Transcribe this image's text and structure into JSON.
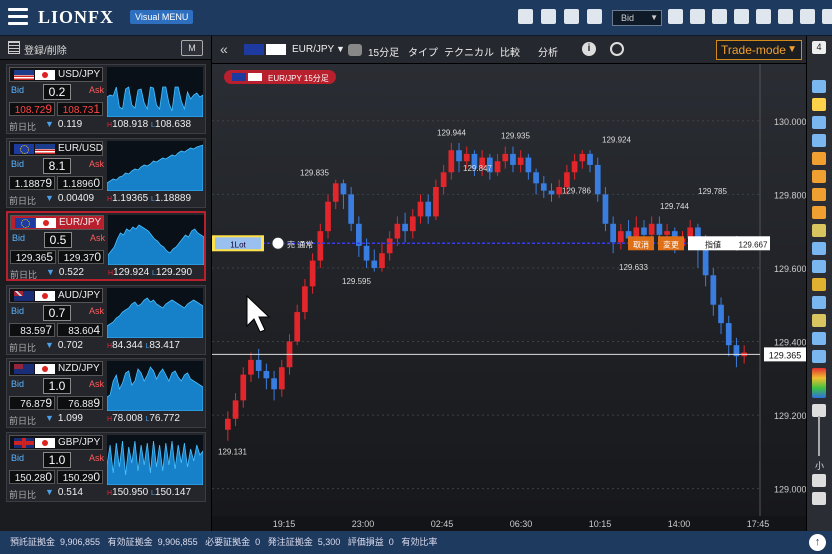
{
  "app": {
    "logo": "LIONFX",
    "logo_badge": "Visual MENU",
    "bid_select": "Bid"
  },
  "sidebar": {
    "title": "登録/削除",
    "m_button": "M",
    "cards": [
      {
        "pair": "USD/JPY",
        "flags": [
          "fl-us",
          "fl-jp"
        ],
        "spread": "0.2",
        "bid_main": "108.72",
        "bid_sub": "9",
        "ask_main": "108.73",
        "ask_sub": "1",
        "red": true,
        "change_label": "前日比",
        "change": "0.119",
        "high": "108.918",
        "low": "108.638",
        "spark": [
          20,
          22,
          21,
          30,
          10,
          8,
          28,
          30,
          12,
          9,
          27,
          28,
          14,
          8,
          30,
          29,
          12,
          8,
          30,
          30,
          14,
          6,
          30,
          30,
          16,
          8,
          25,
          18,
          22,
          24,
          20,
          22
        ]
      },
      {
        "pair": "EUR/USD",
        "flags": [
          "fl-eu",
          "fl-us"
        ],
        "spread": "8.1",
        "bid_main": "1.1887",
        "bid_sub": "9",
        "ask_main": "1.1896",
        "ask_sub": "0",
        "red": false,
        "change_label": "前日比",
        "change": "0.00409",
        "high": "1.19365",
        "low": "1.18889",
        "spark": [
          8,
          10,
          12,
          11,
          14,
          15,
          18,
          17,
          20,
          22,
          21,
          24,
          26,
          25,
          27,
          30,
          29,
          31,
          33,
          32,
          34,
          36,
          35,
          38,
          40,
          39,
          41,
          43,
          42,
          44,
          45,
          46
        ]
      },
      {
        "pair": "EUR/JPY",
        "flags": [
          "fl-eu",
          "fl-jp"
        ],
        "spread": "0.5",
        "bid_main": "129.36",
        "bid_sub": "5",
        "ask_main": "129.37",
        "ask_sub": "0",
        "red": false,
        "selected": true,
        "change_label": "前日比",
        "change": "0.522",
        "high": "129.924",
        "low": "129.290",
        "spark": [
          10,
          14,
          18,
          26,
          32,
          30,
          36,
          34,
          38,
          36,
          40,
          38,
          36,
          34,
          30,
          26,
          24,
          20,
          18,
          14,
          12,
          16,
          18,
          22,
          26,
          30,
          28,
          34,
          36,
          32,
          30,
          28
        ]
      },
      {
        "pair": "AUD/JPY",
        "flags": [
          "fl-au",
          "fl-jp"
        ],
        "spread": "0.7",
        "bid_main": "83.59",
        "bid_sub": "7",
        "ask_main": "83.60",
        "ask_sub": "4",
        "red": false,
        "change_label": "前日比",
        "change": "0.702",
        "high": "84.344",
        "low": "83.417",
        "spark": [
          12,
          14,
          16,
          20,
          22,
          26,
          28,
          30,
          34,
          36,
          32,
          34,
          38,
          40,
          36,
          38,
          34,
          32,
          30,
          34,
          36,
          38,
          36,
          34,
          32,
          30,
          34,
          36,
          38,
          36,
          34,
          32
        ]
      },
      {
        "pair": "NZD/JPY",
        "flags": [
          "fl-nz",
          "fl-jp"
        ],
        "spread": "1.0",
        "bid_main": "76.87",
        "bid_sub": "9",
        "ask_main": "76.88",
        "ask_sub": "9",
        "red": false,
        "change_label": "前日比",
        "change": "1.099",
        "high": "78.008",
        "low": "76.772",
        "spark": [
          14,
          16,
          30,
          36,
          22,
          28,
          38,
          40,
          26,
          30,
          42,
          38,
          30,
          36,
          44,
          40,
          32,
          38,
          42,
          36,
          30,
          38,
          40,
          34,
          30,
          36,
          38,
          32,
          30,
          28,
          26,
          24
        ]
      },
      {
        "pair": "GBP/JPY",
        "flags": [
          "fl-gb",
          "fl-jp"
        ],
        "spread": "1.0",
        "bid_main": "150.28",
        "bid_sub": "0",
        "ask_main": "150.29",
        "ask_sub": "0",
        "red": false,
        "change_label": "前日比",
        "change": "0.514",
        "high": "150.950",
        "low": "150.147",
        "spark": [
          20,
          40,
          12,
          42,
          18,
          44,
          10,
          38,
          22,
          44,
          14,
          40,
          20,
          42,
          12,
          44,
          18,
          40,
          14,
          42,
          20,
          44,
          16,
          40,
          22,
          42,
          18,
          36,
          24,
          40,
          30,
          34
        ]
      }
    ]
  },
  "chart_toolbar": {
    "pair": "EUR/JPY",
    "timeframe": "15分足",
    "type": "タイプ",
    "technical": "テクニカル",
    "compare": "比較",
    "analysis": "分析",
    "trade_mode": "Trade-mode"
  },
  "chart_data": {
    "type": "candlestick",
    "title": "EUR/JPY 15分足",
    "ylim": [
      128.98,
      130.1
    ],
    "y_ticks": [
      "130.000",
      "129.800",
      "129.600",
      "129.400",
      "129.200",
      "129.000"
    ],
    "x_ticks": [
      "19:15",
      "23:00",
      "02:45",
      "06:30",
      "10:15",
      "14:00",
      "17:45"
    ],
    "annotations": [
      "129.944",
      "129.935",
      "129.924",
      "129.835",
      "129.847",
      "129.786",
      "129.744",
      "129.785",
      "129.633",
      "129.595",
      "129.131"
    ],
    "current_price": "129.365",
    "order_line": {
      "price": "129.667",
      "lot": "1Lot",
      "type": "売 通常",
      "cancel": "取消",
      "change": "変更",
      "limit": "指値"
    },
    "candles": [
      [
        129.16,
        129.19,
        129.13,
        129.21
      ],
      [
        129.19,
        129.24,
        129.17,
        129.26
      ],
      [
        129.24,
        129.31,
        129.22,
        129.33
      ],
      [
        129.31,
        129.35,
        129.29,
        129.37
      ],
      [
        129.35,
        129.32,
        129.3,
        129.38
      ],
      [
        129.32,
        129.3,
        129.27,
        129.34
      ],
      [
        129.3,
        129.27,
        129.24,
        129.32
      ],
      [
        129.27,
        129.33,
        129.25,
        129.35
      ],
      [
        129.33,
        129.4,
        129.31,
        129.42
      ],
      [
        129.4,
        129.48,
        129.39,
        129.5
      ],
      [
        129.48,
        129.55,
        129.46,
        129.57
      ],
      [
        129.55,
        129.62,
        129.53,
        129.64
      ],
      [
        129.62,
        129.7,
        129.6,
        129.72
      ],
      [
        129.7,
        129.78,
        129.68,
        129.8
      ],
      [
        129.78,
        129.83,
        129.76,
        129.84
      ],
      [
        129.83,
        129.8,
        129.76,
        129.84
      ],
      [
        129.8,
        129.72,
        129.7,
        129.82
      ],
      [
        129.72,
        129.66,
        129.63,
        129.74
      ],
      [
        129.66,
        129.62,
        129.6,
        129.68
      ],
      [
        129.62,
        129.6,
        129.59,
        129.65
      ],
      [
        129.6,
        129.64,
        129.59,
        129.67
      ],
      [
        129.64,
        129.68,
        129.62,
        129.7
      ],
      [
        129.68,
        129.72,
        129.66,
        129.74
      ],
      [
        129.72,
        129.7,
        129.67,
        129.75
      ],
      [
        129.7,
        129.74,
        129.68,
        129.76
      ],
      [
        129.74,
        129.78,
        129.72,
        129.8
      ],
      [
        129.78,
        129.74,
        129.72,
        129.8
      ],
      [
        129.74,
        129.82,
        129.73,
        129.84
      ],
      [
        129.82,
        129.86,
        129.8,
        129.88
      ],
      [
        129.86,
        129.92,
        129.84,
        129.94
      ],
      [
        129.92,
        129.89,
        129.86,
        129.94
      ],
      [
        129.89,
        129.91,
        129.87,
        129.93
      ],
      [
        129.91,
        129.87,
        129.85,
        129.92
      ],
      [
        129.87,
        129.9,
        129.85,
        129.92
      ],
      [
        129.9,
        129.86,
        129.84,
        129.91
      ],
      [
        129.86,
        129.89,
        129.85,
        129.91
      ],
      [
        129.89,
        129.91,
        129.87,
        129.93
      ],
      [
        129.91,
        129.88,
        129.86,
        129.93
      ],
      [
        129.88,
        129.9,
        129.86,
        129.92
      ],
      [
        129.9,
        129.86,
        129.84,
        129.91
      ],
      [
        129.86,
        129.83,
        129.8,
        129.87
      ],
      [
        129.83,
        129.81,
        129.79,
        129.85
      ],
      [
        129.81,
        129.8,
        129.78,
        129.83
      ],
      [
        129.8,
        129.82,
        129.79,
        129.84
      ],
      [
        129.82,
        129.86,
        129.8,
        129.88
      ],
      [
        129.86,
        129.89,
        129.84,
        129.91
      ],
      [
        129.89,
        129.91,
        129.87,
        129.92
      ],
      [
        129.91,
        129.88,
        129.86,
        129.92
      ],
      [
        129.88,
        129.8,
        129.78,
        129.9
      ],
      [
        129.8,
        129.72,
        129.7,
        129.82
      ],
      [
        129.72,
        129.67,
        129.64,
        129.74
      ],
      [
        129.67,
        129.7,
        129.65,
        129.72
      ],
      [
        129.7,
        129.68,
        129.66,
        129.73
      ],
      [
        129.68,
        129.71,
        129.66,
        129.74
      ],
      [
        129.71,
        129.69,
        129.67,
        129.73
      ],
      [
        129.69,
        129.72,
        129.68,
        129.74
      ],
      [
        129.72,
        129.69,
        129.67,
        129.74
      ],
      [
        129.69,
        129.7,
        129.67,
        129.72
      ],
      [
        129.7,
        129.66,
        129.64,
        129.71
      ],
      [
        129.66,
        129.68,
        129.65,
        129.7
      ],
      [
        129.68,
        129.71,
        129.66,
        129.73
      ],
      [
        129.71,
        129.68,
        129.6,
        129.72
      ],
      [
        129.68,
        129.58,
        129.55,
        129.69
      ],
      [
        129.58,
        129.5,
        129.47,
        129.6
      ],
      [
        129.5,
        129.45,
        129.42,
        129.52
      ],
      [
        129.45,
        129.39,
        129.36,
        129.47
      ],
      [
        129.39,
        129.36,
        129.33,
        129.41
      ],
      [
        129.36,
        129.37,
        129.34,
        129.39
      ]
    ]
  },
  "bottom_bar": {
    "deposit_label": "預託証拠金",
    "deposit": "9,906,855",
    "effective_label": "有効証拠金",
    "effective": "9,906,855",
    "required_label": "必要証拠金",
    "required": "0",
    "order_label": "発注証拠金",
    "order": "5,300",
    "pnl_label": "評価損益",
    "pnl": "0",
    "ratio_label": "有効比率",
    "ratio": ""
  },
  "colors": {
    "up": "#e2262b",
    "down": "#3a7de0",
    "accent": "#f0a030",
    "brand": "#1f3a5f"
  }
}
